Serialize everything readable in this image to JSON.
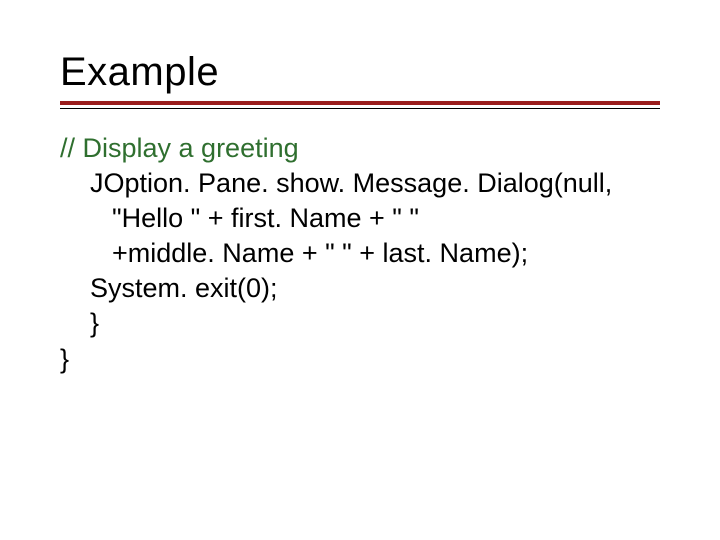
{
  "slide": {
    "title": "Example",
    "lines": {
      "comment": "// Display a greeting",
      "l1": "JOption. Pane. show. Message. Dialog(null,",
      "l2": "\"Hello \" + first. Name + \" \"",
      "l3": "+middle. Name + \" \" + last. Name);",
      "l4": "System. exit(0);",
      "l5": "}",
      "l6": "}"
    }
  }
}
